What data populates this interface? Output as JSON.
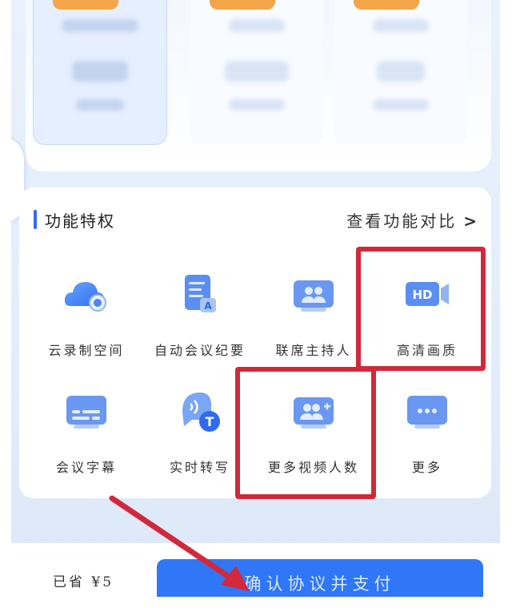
{
  "features_section": {
    "title": "功能特权",
    "compare_link": "查看功能对比",
    "compare_chevron": ">"
  },
  "features": [
    {
      "label": "云录制空间",
      "icon": "cloud-record-icon"
    },
    {
      "label": "自动会议纪要",
      "icon": "auto-minutes-icon"
    },
    {
      "label": "联席主持人",
      "icon": "co-host-icon"
    },
    {
      "label": "高清画质",
      "icon": "hd-video-icon"
    },
    {
      "label": "会议字幕",
      "icon": "subtitles-icon"
    },
    {
      "label": "实时转写",
      "icon": "transcribe-icon"
    },
    {
      "label": "更多视频人数",
      "icon": "more-participants-icon"
    },
    {
      "label": "更多",
      "icon": "more-icon"
    }
  ],
  "bottom_bar": {
    "saved_text": "已省 ¥5",
    "pay_button": "确认协议并支付"
  },
  "colors": {
    "primary": "#2f77f6",
    "highlight": "#d3283b",
    "accent_tag": "#f6a64a"
  }
}
